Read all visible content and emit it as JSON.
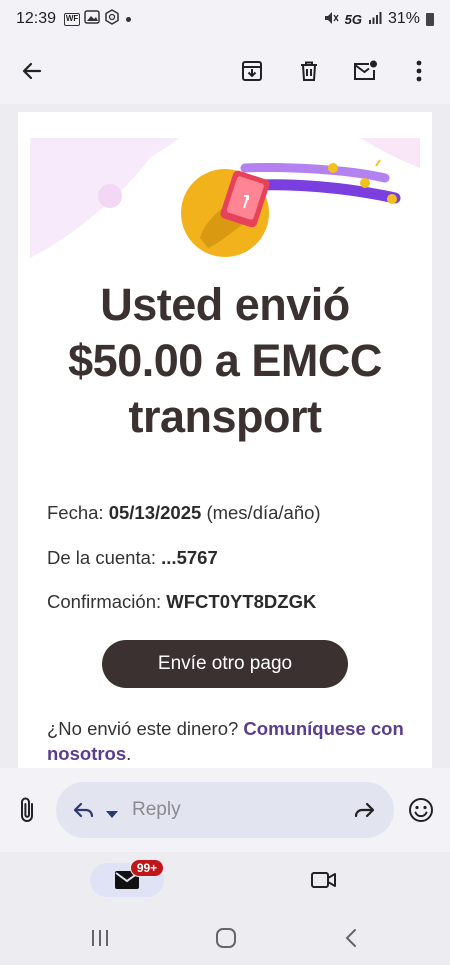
{
  "status_bar": {
    "time": "12:39",
    "notif_icons": [
      "WF",
      "image",
      "crypto"
    ],
    "network": "5G",
    "battery": "31%"
  },
  "toolbar": {
    "back": "back-arrow-icon",
    "archive": "archive-icon",
    "delete": "trash-icon",
    "mark_unread": "mail-unread-icon",
    "more": "more-vert-icon"
  },
  "email": {
    "headline_lines": [
      "Usted envió",
      "$50.00 a EMCC",
      "transport"
    ],
    "date_label": "Fecha:",
    "date_value": "05/13/2025",
    "date_format": "(mes/día/año)",
    "account_label": "De la cuenta:",
    "account_value": "...5767",
    "confirmation_label": "Confirmación:",
    "confirmation_value": "WFCT0YT8DZGK",
    "cta_label": "Envíe otro pago",
    "help_text": "¿No envió este dinero?",
    "help_link": "Comuníquese con nosotros",
    "help_period": "."
  },
  "reply_bar": {
    "placeholder": "Reply"
  },
  "bottom_nav": {
    "mail_badge": "99+"
  },
  "colors": {
    "cta_bg": "#3b3130",
    "link": "#5a3e8e",
    "badge": "#c0161a",
    "accent_purple": "#7b3fe0",
    "accent_gold": "#f2b21c"
  }
}
